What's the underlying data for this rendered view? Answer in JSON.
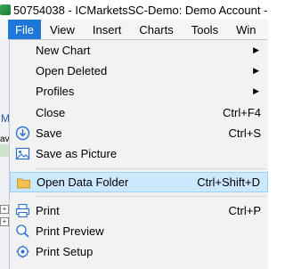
{
  "window": {
    "title": "50754038 - ICMarketsSC-Demo: Demo Account -"
  },
  "menubar": {
    "items": [
      {
        "label": "File"
      },
      {
        "label": "View"
      },
      {
        "label": "Insert"
      },
      {
        "label": "Charts"
      },
      {
        "label": "Tools"
      },
      {
        "label": "Win"
      }
    ]
  },
  "left_strip": {
    "m_label": "M",
    "av_label": "av"
  },
  "file_menu": {
    "items": [
      {
        "label": "New Chart",
        "shortcut": "",
        "submenu": true
      },
      {
        "label": "Open Deleted",
        "shortcut": "",
        "submenu": true
      },
      {
        "label": "Profiles",
        "shortcut": "",
        "submenu": true
      },
      {
        "label": "Close",
        "shortcut": "Ctrl+F4",
        "submenu": false
      },
      {
        "label": "Save",
        "shortcut": "Ctrl+S",
        "icon": "save-icon"
      },
      {
        "label": "Save as Picture",
        "shortcut": "",
        "icon": "picture-icon"
      },
      {
        "label": "Open Data Folder",
        "shortcut": "Ctrl+Shift+D",
        "icon": "folder-icon"
      },
      {
        "label": "Print",
        "shortcut": "Ctrl+P",
        "icon": "printer-icon"
      },
      {
        "label": "Print Preview",
        "shortcut": "",
        "icon": "print-preview-icon"
      },
      {
        "label": "Print Setup",
        "shortcut": "",
        "icon": "print-setup-icon"
      }
    ],
    "submenu_arrow": "▶"
  },
  "colors": {
    "menu_active": "#1f78d7",
    "highlight": "#cce8ff"
  }
}
